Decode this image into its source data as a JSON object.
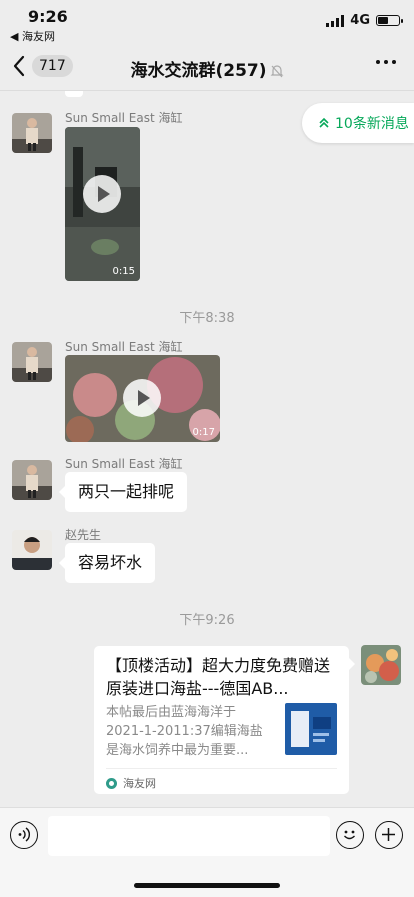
{
  "status_bar": {
    "time": "9:26",
    "back_app": "◀ 海友网",
    "network": "4G",
    "battery_level": 0.45
  },
  "nav": {
    "unread_count": "717",
    "title": "海水交流群(257)"
  },
  "new_messages": {
    "label": "10条新消息"
  },
  "messages": [
    {
      "sender": "Sun Small East 海缸",
      "video_duration": "0:15"
    },
    {
      "timestamp": "下午8:38"
    },
    {
      "sender": "Sun Small East 海缸",
      "video_duration": "0:17"
    },
    {
      "sender": "Sun Small East 海缸",
      "text": "两只一起排呢"
    },
    {
      "sender": "赵先生",
      "text": "容易坏水"
    },
    {
      "timestamp": "下午9:26"
    },
    {
      "card": {
        "title": "【顶楼活动】超大力度免费赠送原装进口海盐---德国AB...",
        "desc": "本帖最后由蓝海海洋于2021-1-2011:37编辑海盐是海水饲养中最为重要...",
        "source": "海友网"
      }
    }
  ]
}
